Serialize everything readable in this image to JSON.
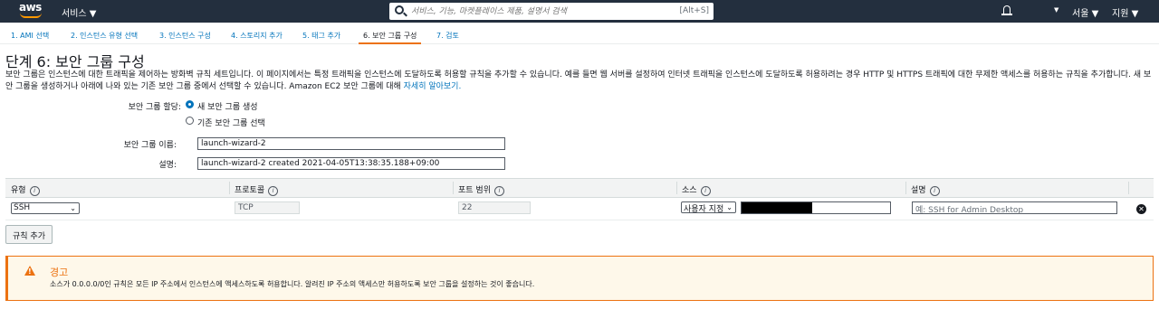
{
  "topbar": {
    "logo": "aws",
    "services_label": "서비스 ▼",
    "search_placeholder": "서비스, 기능, 마켓플레이스 제품, 설명서 검색",
    "search_shortcut": "[Alt+S]",
    "region_label": "서울 ▼",
    "support_label": "지원 ▼"
  },
  "steps": [
    "1. AMI 선택",
    "2. 인스턴스 유형 선택",
    "3. 인스턴스 구성",
    "4. 스토리지 추가",
    "5. 태그 추가",
    "6. 보안 그룹 구성",
    "7. 검토"
  ],
  "active_step": 5,
  "page": {
    "title": "단계 6: 보안 그룹 구성",
    "description": "보안 그룹은 인스턴스에 대한 트래픽을 제어하는 방화벽 규칙 세트입니다. 이 페이지에서는 특정 트래픽을 인스턴스에 도달하도록 허용할 규칙을 추가할 수 있습니다. 예를 들면 웹 서버를 설정하여 인터넷 트래픽을 인스턴스에 도달하도록 허용하려는 경우 HTTP 및 HTTPS 트래픽에 대한 무제한 액세스를 허용하는 규칙을 추가합니다. 새 보안 그룹을 생성하거나 아래에 나와 있는 기존 보안 그룹 중에서 선택할 수 있습니다. Amazon EC2 보안 그룹에 대해 ",
    "learn_more": "자세히 알아보기."
  },
  "form": {
    "assign_label": "보안 그룹 할당:",
    "option_new": "새 보안 그룹 생성",
    "option_existing": "기존 보안 그룹 선택",
    "name_label": "보안 그룹 이름:",
    "name_value": "launch-wizard-2",
    "desc_label": "설명:",
    "desc_value": "launch-wizard-2 created 2021-04-05T13:38:35.188+09:00"
  },
  "table": {
    "columns": [
      "유형",
      "프로토콜",
      "포트 범위",
      "소스",
      "설명"
    ],
    "row": {
      "type": "SSH",
      "protocol": "TCP",
      "port": "22",
      "source": "사용자 지정",
      "desc_placeholder": "예: SSH for Admin Desktop"
    }
  },
  "add_rule_label": "규칙 추가",
  "warning": {
    "title": "경고",
    "text": "소스가 0.0.0.0/0인 규칙은 모든 IP 주소에서 인스턴스에 액세스하도록 허용합니다. 알려진 IP 주소의 액세스만 허용하도록 보안 그룹을 설정하는 것이 좋습니다."
  },
  "colors": {
    "accent": "#ec7211",
    "link": "#0073bb",
    "nav": "#232f3e"
  }
}
